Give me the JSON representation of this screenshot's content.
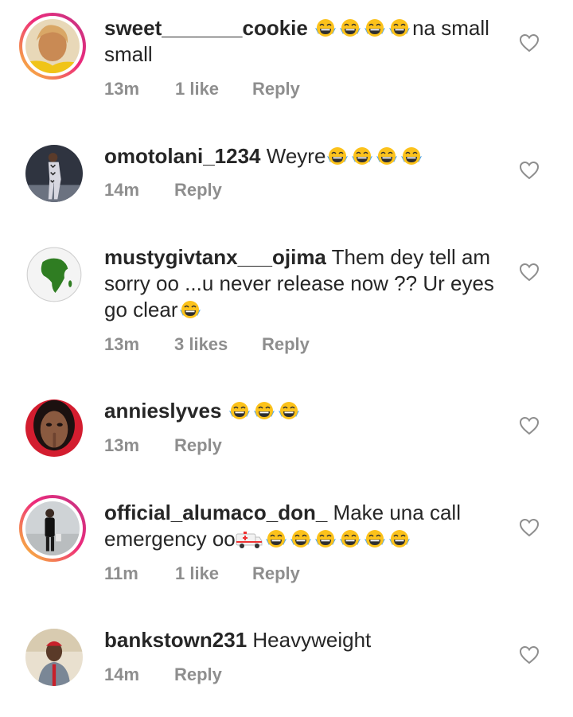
{
  "comments": [
    {
      "username": "sweet_______cookie",
      "text": "na small small",
      "emoji_before_text": 4,
      "emoji_after_text": 0,
      "time": "13m",
      "likes": "1 like",
      "reply": "Reply",
      "story_ring": true,
      "avatar": "woman-yellow-avatar"
    },
    {
      "username": "omotolani_1234",
      "text": "Weyre",
      "emoji_before_text": 0,
      "emoji_after_text": 4,
      "time": "14m",
      "likes": "",
      "reply": "Reply",
      "story_ring": false,
      "avatar": "woman-dark-outfit-avatar"
    },
    {
      "username": "mustygivtanx___ojima",
      "text": "Them dey tell am sorry oo ...u never release now ?? Ur eyes go clear",
      "emoji_before_text": 0,
      "emoji_after_text": 1,
      "time": "13m",
      "likes": "3 likes",
      "reply": "Reply",
      "story_ring": false,
      "avatar": "africa-globe-avatar"
    },
    {
      "username": "annieslyves",
      "text": "",
      "emoji_before_text": 0,
      "emoji_after_text": 3,
      "time": "13m",
      "likes": "",
      "reply": "Reply",
      "story_ring": false,
      "avatar": "woman-finger-lips-avatar"
    },
    {
      "username": "official_alumaco_don_",
      "text": "Make una call emergency oo",
      "emoji_before_text": 0,
      "emoji_after_text": 6,
      "has_ambulance": true,
      "time": "11m",
      "likes": "1 like",
      "reply": "Reply",
      "story_ring": true,
      "avatar": "man-standing-avatar"
    },
    {
      "username": "bankstown231",
      "text": "Heavyweight",
      "emoji_before_text": 0,
      "emoji_after_text": 0,
      "time": "14m",
      "likes": "",
      "reply": "Reply",
      "story_ring": false,
      "avatar": "man-red-cap-avatar"
    }
  ],
  "icons": {
    "like": "heart-outline-icon",
    "laugh": "face-with-tears-of-joy-emoji",
    "ambulance": "ambulance-emoji"
  },
  "colors": {
    "text": "#262626",
    "meta": "#8e8e8e",
    "ring_start": "#f9ce34",
    "ring_end": "#c13584"
  }
}
